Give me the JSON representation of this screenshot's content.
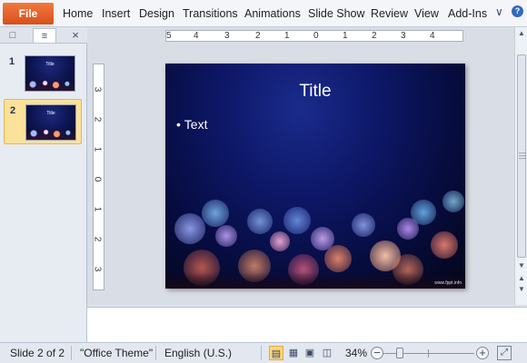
{
  "ribbon": {
    "file_label": "File",
    "tabs": [
      "Home",
      "Insert",
      "Design",
      "Transitions",
      "Animations",
      "Slide Show",
      "Review",
      "View",
      "Add-Ins"
    ],
    "icons": [
      "minimize-ribbon-icon",
      "help-icon"
    ]
  },
  "slides_pane": {
    "tabs": [
      "slides-tab",
      "outline-tab"
    ],
    "close_icon": "close-icon",
    "thumbnails": [
      {
        "number": "1",
        "selected": false
      },
      {
        "number": "2",
        "selected": true
      }
    ]
  },
  "rulers": {
    "horizontal": [
      "5",
      "4",
      "3",
      "2",
      "1",
      "0",
      "1",
      "2",
      "3",
      "4"
    ],
    "vertical": [
      "3",
      "2",
      "1",
      "0",
      "1",
      "2",
      "3"
    ]
  },
  "slide": {
    "title": "Title",
    "bullet": "Text",
    "credit": "www.fppt.info"
  },
  "status_bar": {
    "slide_info": "Slide 2 of 2",
    "theme": "\"Office Theme\"",
    "language": "English (U.S.)",
    "zoom": "34%",
    "view_buttons": [
      "normal-view",
      "slide-sorter-view",
      "reading-view",
      "slide-show-view"
    ],
    "active_view": "normal-view"
  },
  "colors": {
    "file_tab": "#e0602a",
    "selection": "#fbe19a",
    "slide_bg": "#0d1766"
  }
}
